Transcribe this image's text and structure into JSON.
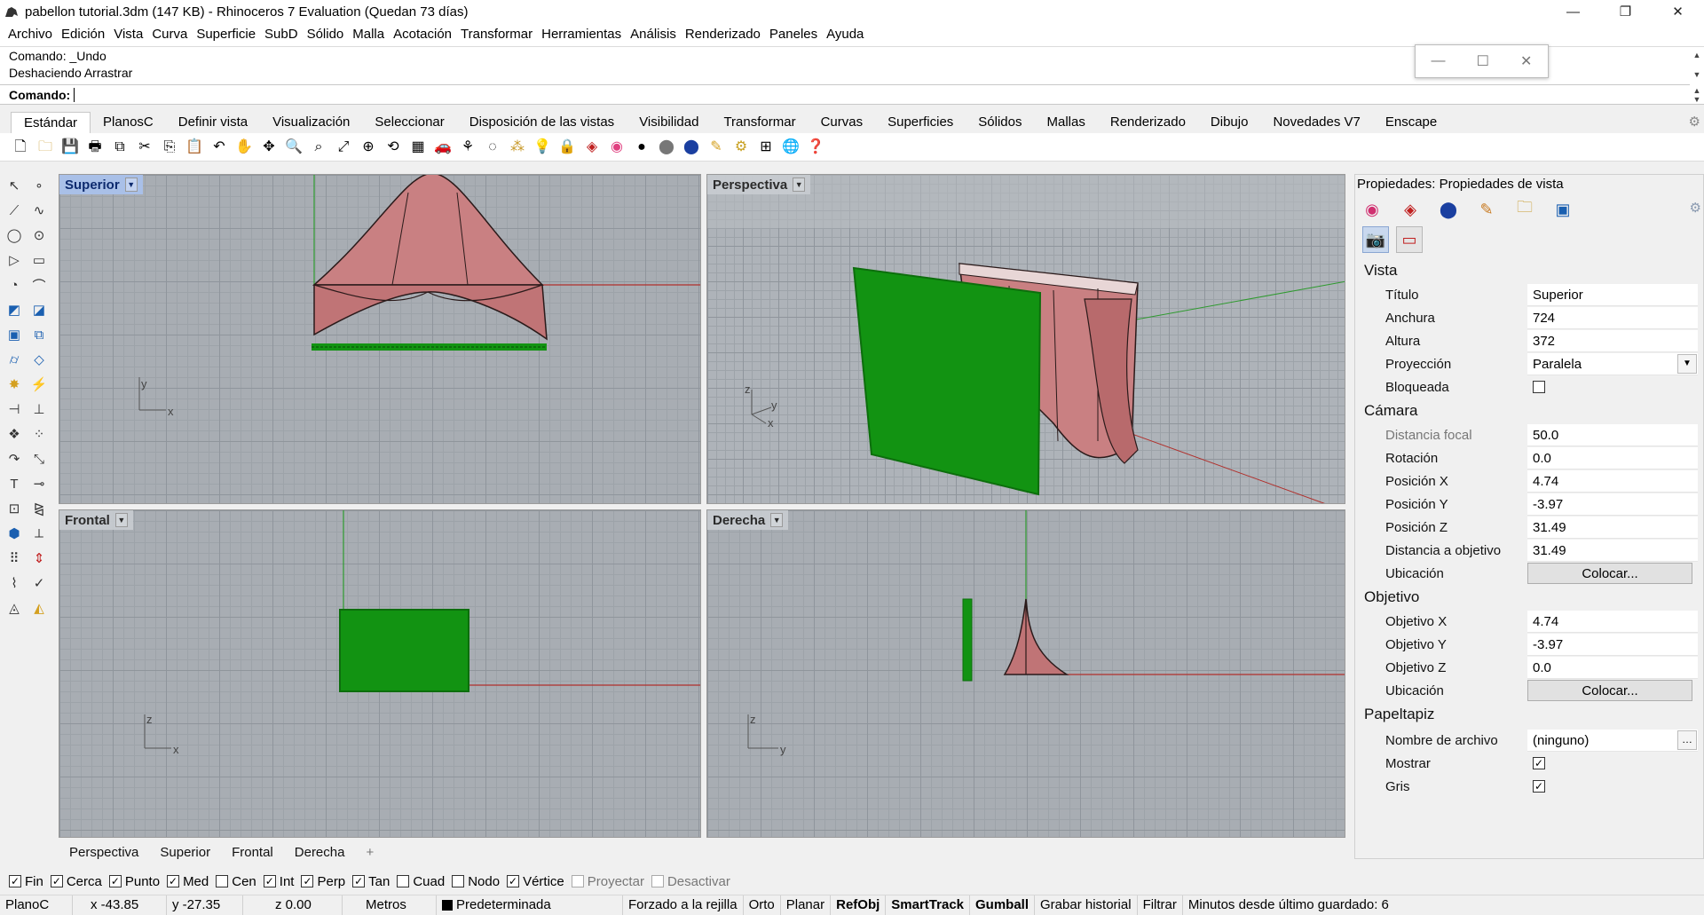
{
  "window": {
    "title": "pabellon tutorial.3dm (147 KB) - Rhinoceros 7 Evaluation (Quedan 73 días)",
    "minimize": "—",
    "restore": "❐",
    "close": "✕"
  },
  "menu": [
    "Archivo",
    "Edición",
    "Vista",
    "Curva",
    "Superficie",
    "SubD",
    "Sólido",
    "Malla",
    "Acotación",
    "Transformar",
    "Herramientas",
    "Análisis",
    "Renderizado",
    "Paneles",
    "Ayuda"
  ],
  "command": {
    "history": [
      "Comando: _Undo",
      "Deshaciendo Arrastrar"
    ],
    "prompt_label": "Comando:"
  },
  "toolbar_tabs": [
    "Estándar",
    "PlanosC",
    "Definir vista",
    "Visualización",
    "Seleccionar",
    "Disposición de las vistas",
    "Visibilidad",
    "Transformar",
    "Curvas",
    "Superficies",
    "Sólidos",
    "Mallas",
    "Renderizado",
    "Dibujo",
    "Novedades V7",
    "Enscape"
  ],
  "toolbar_icons": [
    "new-icon",
    "open-icon",
    "save-icon",
    "print-icon",
    "export-icon",
    "cut-icon",
    "copy-icon",
    "paste-icon",
    "undo-icon",
    "pan-icon",
    "rotate-view-icon",
    "zoom-icon",
    "zoom-window-icon",
    "zoom-extents-icon",
    "zoom-selected-icon",
    "undo-view-icon",
    "four-view-icon",
    "car-icon",
    "toy-icon",
    "ellipse-icon",
    "select-points-icon",
    "light-icon",
    "lock-icon",
    "layer-icon",
    "color-wheel-icon",
    "shade-icon",
    "render-sphere-icon",
    "material-sphere-icon",
    "highlighter-icon",
    "options-gear-icon",
    "dimension-icon",
    "globe-icon",
    "help-icon"
  ],
  "viewports": {
    "top": {
      "label": "Superior",
      "axis_a": "y",
      "axis_b": "x"
    },
    "perspective": {
      "label": "Perspectiva",
      "axis_a": "z",
      "axis_b": "y",
      "axis_c": "x"
    },
    "front": {
      "label": "Frontal",
      "axis_a": "z",
      "axis_b": "x"
    },
    "right": {
      "label": "Derecha",
      "axis_a": "z",
      "axis_b": "y"
    }
  },
  "viewport_tabs": [
    "Perspectiva",
    "Superior",
    "Frontal",
    "Derecha",
    "+"
  ],
  "osnaps": [
    {
      "label": "Fin",
      "checked": true
    },
    {
      "label": "Cerca",
      "checked": true
    },
    {
      "label": "Punto",
      "checked": true
    },
    {
      "label": "Med",
      "checked": true
    },
    {
      "label": "Cen",
      "checked": false
    },
    {
      "label": "Int",
      "checked": true
    },
    {
      "label": "Perp",
      "checked": true
    },
    {
      "label": "Tan",
      "checked": true
    },
    {
      "label": "Cuad",
      "checked": false
    },
    {
      "label": "Nodo",
      "checked": false
    },
    {
      "label": "Vértice",
      "checked": true
    },
    {
      "label": "Proyectar",
      "checked": false
    },
    {
      "label": "Desactivar",
      "checked": false
    }
  ],
  "status": {
    "cplane": "PlanoC",
    "x": "x -43.85",
    "y": "y -27.35",
    "z": "z 0.00",
    "units": "Metros",
    "layer": "Predeterminada",
    "grid_snap": "Forzado a la rejilla",
    "ortho": "Orto",
    "planar": "Planar",
    "osnap": "RefObj",
    "smarttrack": "SmartTrack",
    "gumball": "Gumball",
    "history": "Grabar historial",
    "filter": "Filtrar",
    "autosave": "Minutos desde último guardado: 6"
  },
  "properties": {
    "title": "Propiedades: Propiedades de vista",
    "sections": {
      "vista": "Vista",
      "camara": "Cámara",
      "objetivo": "Objetivo",
      "papeltapiz": "Papeltapiz"
    },
    "vista": {
      "titulo_label": "Título",
      "titulo": "Superior",
      "anchura_label": "Anchura",
      "anchura": "724",
      "altura_label": "Altura",
      "altura": "372",
      "proyeccion_label": "Proyección",
      "proyeccion": "Paralela",
      "bloqueada_label": "Bloqueada"
    },
    "camara": {
      "focal_label": "Distancia focal",
      "focal": "50.0",
      "rotacion_label": "Rotación",
      "rotacion": "0.0",
      "px_label": "Posición X",
      "px": "4.74",
      "py_label": "Posición Y",
      "py": "-3.97",
      "pz_label": "Posición Z",
      "pz": "31.49",
      "dist_label": "Distancia a objetivo",
      "dist": "31.49",
      "ubic_label": "Ubicación",
      "ubic_button": "Colocar..."
    },
    "objetivo": {
      "ox_label": "Objetivo X",
      "ox": "4.74",
      "oy_label": "Objetivo Y",
      "oy": "-3.97",
      "oz_label": "Objetivo Z",
      "oz": "0.0",
      "ubic_label": "Ubicación",
      "ubic_button": "Colocar..."
    },
    "papeltapiz": {
      "archivo_label": "Nombre de archivo",
      "archivo": "(ninguno)",
      "mostrar_label": "Mostrar",
      "gris_label": "Gris"
    }
  },
  "colors": {
    "surface": "#c98082",
    "mesh_green": "#129312",
    "x_axis": "#b0302c",
    "y_axis": "#2e9a2e",
    "active_label": "#a9c0e8"
  }
}
